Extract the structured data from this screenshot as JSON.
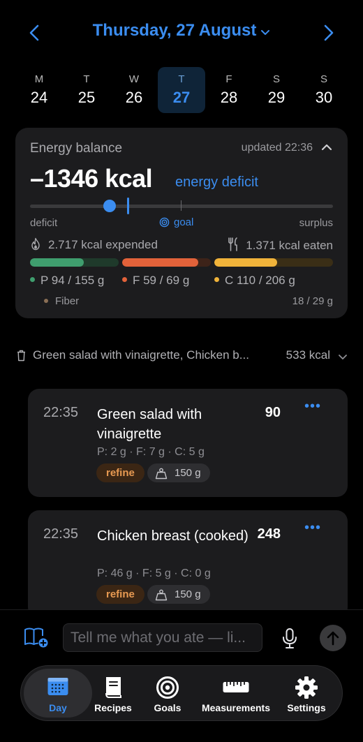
{
  "header": {
    "date_title": "Thursday, 27 August",
    "prev_icon": "chevron-left-icon",
    "next_icon": "chevron-right-icon"
  },
  "week": [
    {
      "wd": "M",
      "dn": "24"
    },
    {
      "wd": "T",
      "dn": "25"
    },
    {
      "wd": "W",
      "dn": "26"
    },
    {
      "wd": "T",
      "dn": "27",
      "selected": true
    },
    {
      "wd": "F",
      "dn": "28"
    },
    {
      "wd": "S",
      "dn": "29"
    },
    {
      "wd": "S",
      "dn": "30"
    }
  ],
  "energy": {
    "title": "Energy balance",
    "updated": "updated 22:36",
    "kcal": "–1346 kcal",
    "status": "energy deficit",
    "label_deficit": "deficit",
    "label_goal": "goal",
    "label_surplus": "surplus",
    "expended": "2.717 kcal expended",
    "eaten": "1.371 kcal eaten",
    "macros": {
      "protein": {
        "text": "P 94 / 155 g",
        "fraction": 0.61,
        "color": "#3f9e6e"
      },
      "fat": {
        "text": "F 59 / 69 g",
        "fraction": 0.86,
        "color": "#e2623a"
      },
      "carbs": {
        "text": "C 110 / 206 g",
        "fraction": 0.53,
        "color": "#f0b33a"
      }
    },
    "fiber_label": "Fiber",
    "fiber_value": "18 / 29 g"
  },
  "meal_summary": {
    "names": "Green salad with vinaigrette, Chicken b...",
    "kcal": "533 kcal",
    "icon": "trash-icon"
  },
  "entries": [
    {
      "time": "22:35",
      "name": "Green salad with vinaigrette",
      "kcal": "90",
      "macros": "P: 2 g · F: 7 g · C: 5 g",
      "refine": "refine",
      "portion": "150 g"
    },
    {
      "time": "22:35",
      "name": "Chicken breast (cooked)",
      "kcal": "248",
      "macros": "P: 46 g · F: 5 g · C: 0 g",
      "refine": "refine",
      "portion": "150 g"
    }
  ],
  "composer": {
    "placeholder": "Tell me what you ate — li..."
  },
  "tabs": {
    "day": "Day",
    "recipes": "Recipes",
    "goals": "Goals",
    "measurements": "Measurements",
    "settings": "Settings"
  },
  "colors": {
    "accent": "#3b8df0",
    "card": "#1c1c1e",
    "refine": "#e89a52"
  }
}
